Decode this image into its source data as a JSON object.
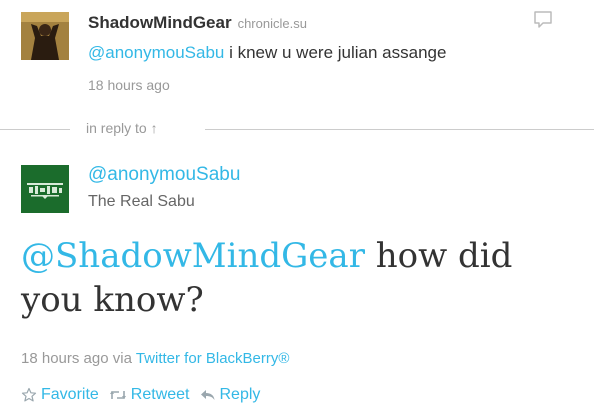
{
  "reply_tweet": {
    "name": "ShadowMindGear",
    "domain": "chronicle.su",
    "mention": "@anonymouSabu",
    "text": "i knew u were julian assange",
    "time": "18 hours ago"
  },
  "divider": {
    "label": "in reply to ↑"
  },
  "main_tweet": {
    "handle": "@anonymouSabu",
    "real_name": "The Real Sabu",
    "mention": "@ShadowMindGear",
    "text": "how did you know?",
    "time": "18 hours ago",
    "via_label": "via",
    "source": "Twitter for BlackBerry®"
  },
  "actions": {
    "favorite": "Favorite",
    "retweet": "Retweet",
    "reply": "Reply"
  },
  "colors": {
    "link": "#33b8e6",
    "text": "#333333",
    "muted": "#999999"
  }
}
